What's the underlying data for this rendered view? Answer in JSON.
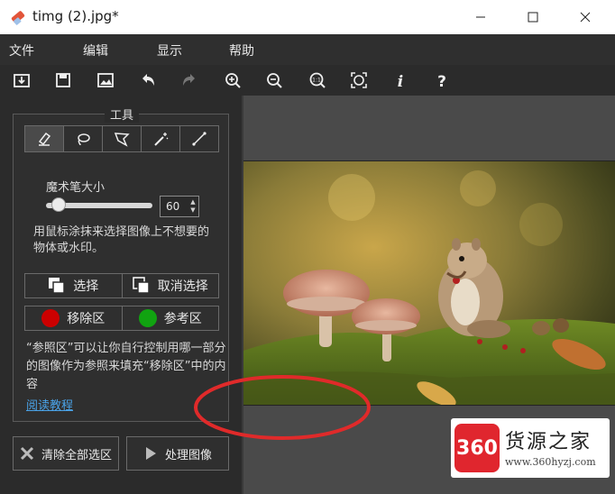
{
  "window": {
    "title": "timg (2).jpg*"
  },
  "menu": {
    "items": [
      "文件",
      "编辑",
      "显示",
      "帮助"
    ]
  },
  "toolbar": {
    "buttons": [
      "open-icon",
      "save-icon",
      "image-icon",
      "undo-icon",
      "redo-icon",
      "zoom-in-icon",
      "zoom-out-icon",
      "zoom-actual-icon",
      "zoom-fit-icon",
      "info-icon",
      "help-icon"
    ]
  },
  "panel": {
    "title": "工具",
    "tools": [
      "marker-icon",
      "lasso-icon",
      "polygon-lasso-icon",
      "magic-wand-icon",
      "line-icon"
    ],
    "brush_label": "魔术笔大小",
    "brush_size": "60",
    "brush_fraction": 0.12,
    "help_text": "用鼠标涂抹来选择图像上不想要的物体或水印。",
    "select_label": "选择",
    "deselect_label": "取消选择",
    "remove_area_label": "移除区",
    "reference_area_label": "参考区",
    "remove_color": "#cc0000",
    "reference_color": "#11a311",
    "note_text": "“参照区”可以让你自行控制用哪一部分的图像作为参照来填充“移除区”中的内容",
    "tutorial_link": "阅读教程"
  },
  "actions": {
    "clear_label": "清除全部选区",
    "process_label": "处理图像"
  },
  "watermark": {
    "logo": "360",
    "name": "货源之家",
    "url": "www.360hyzj.com"
  }
}
